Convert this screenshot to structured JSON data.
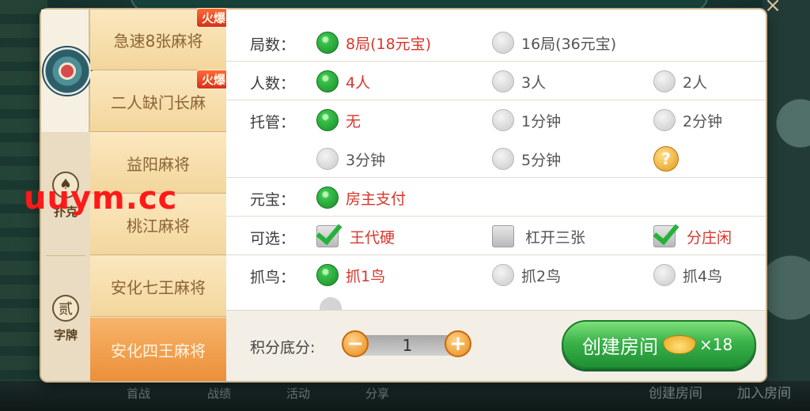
{
  "background": {
    "close_label": "×",
    "bottom_bar": [
      "首战",
      "战绩",
      "活动",
      "分享"
    ],
    "bottom_right": [
      "创建房间",
      "加入房间"
    ]
  },
  "categories": [
    {
      "label": "",
      "icon": "majiang-emblem-icon"
    },
    {
      "label": "扑克",
      "icon": "poker-spade-icon"
    },
    {
      "label": "字牌",
      "icon": "zipai-icon",
      "glyph": "贰"
    }
  ],
  "games": [
    {
      "label": "急速8张麻将",
      "badge": "火爆"
    },
    {
      "label": "二人缺门长麻",
      "badge": "火爆"
    },
    {
      "label": "益阳麻将",
      "badge": ""
    },
    {
      "label": "桃江麻将",
      "badge": ""
    },
    {
      "label": "安化七王麻将",
      "badge": ""
    },
    {
      "label": "安化四王麻将",
      "badge": ""
    }
  ],
  "rows": {
    "rounds": {
      "label": "局数：",
      "options": [
        "8局(18元宝)",
        "16局(36元宝)"
      ]
    },
    "players": {
      "label": "人数：",
      "options": [
        "4人",
        "3人",
        "2人"
      ]
    },
    "hosting": {
      "label": "托管：",
      "options": [
        "无",
        "1分钟",
        "2分钟",
        "3分钟",
        "5分钟"
      ],
      "help": "?"
    },
    "ingot": {
      "label": "元宝：",
      "options": [
        "房主支付"
      ]
    },
    "optional": {
      "label": "可选：",
      "options": [
        "王代硬",
        "杠开三张",
        "分庄闲"
      ]
    },
    "bird": {
      "label": "抓鸟：",
      "options": [
        "抓1鸟",
        "抓2鸟",
        "抓4鸟"
      ]
    }
  },
  "footer": {
    "score_label": "积分底分:",
    "score_value": "1",
    "minus": "−",
    "plus": "+",
    "create_label": "创建房间",
    "cost": "×18"
  },
  "watermark": "uuym.cc",
  "colors": {
    "selected_text": "#d8362b",
    "radio_on": "#39c24a",
    "accent_orange": "#ec8f3a",
    "create_green": "#3ab24a"
  }
}
